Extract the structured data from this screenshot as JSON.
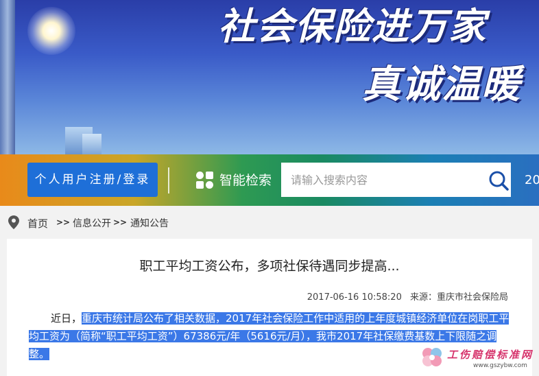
{
  "banner": {
    "slogan_line1": "社会保险进万家",
    "slogan_line2": "真诚温暖"
  },
  "nav": {
    "login_label": "个人用户注册/登录",
    "smart_search_label": "智能检索",
    "search_placeholder": "请输入搜索内容",
    "year_fragment": "20"
  },
  "breadcrumb": {
    "items": [
      "首页",
      "信息公开",
      "通知公告"
    ],
    "separator": ">>"
  },
  "article": {
    "title": "职工平均工资公布，多项社保待遇同步提高...",
    "datetime": "2017-06-16 10:58:20",
    "source": "来源：重庆市社会保险局",
    "lead": "近日，",
    "highlighted_text": "重庆市统计局公布了相关数据，2017年社会保险工作中适用的上年度城镇经济单位在岗职工平均工资为（简称“职工平均工资”）67386元/年（5616元/月），我市2017年社保缴费基数上下限随之调整。"
  },
  "watermark": {
    "text": "工伤赔偿标准网",
    "url": "www.gszybw.com"
  },
  "colors": {
    "login_button": "#1e6fd8",
    "highlight": "#3b78e7",
    "banner_blue": "#2a3ea8"
  },
  "icons": [
    "location-pin-icon",
    "grid-icon",
    "search-icon",
    "flower-icon"
  ]
}
